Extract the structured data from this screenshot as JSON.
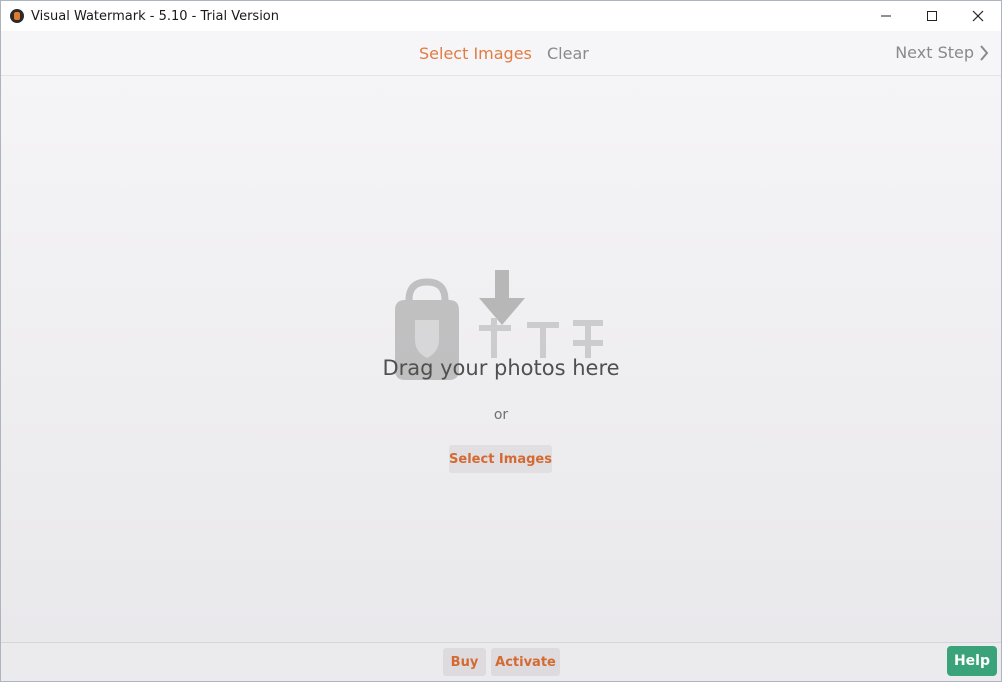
{
  "window": {
    "title": "Visual Watermark - 5.10 - Trial Version",
    "app_icon": "padlock-logo-icon",
    "controls": [
      "minimize-icon",
      "maximize-icon",
      "close-icon"
    ]
  },
  "toolbar": {
    "select_images": "Select Images",
    "clear": "Clear",
    "next_step": "Next Step",
    "next_icon": "chevron-right-icon"
  },
  "drop_area": {
    "drag_text": "Drag your photos here",
    "or_text": "or",
    "select_button": "Select Images"
  },
  "footer": {
    "buy": "Buy",
    "activate": "Activate",
    "help": "Help"
  },
  "colors": {
    "accent_orange": "#e07c44",
    "help_green": "#3aa37a",
    "muted_text": "#8a8a8e"
  }
}
